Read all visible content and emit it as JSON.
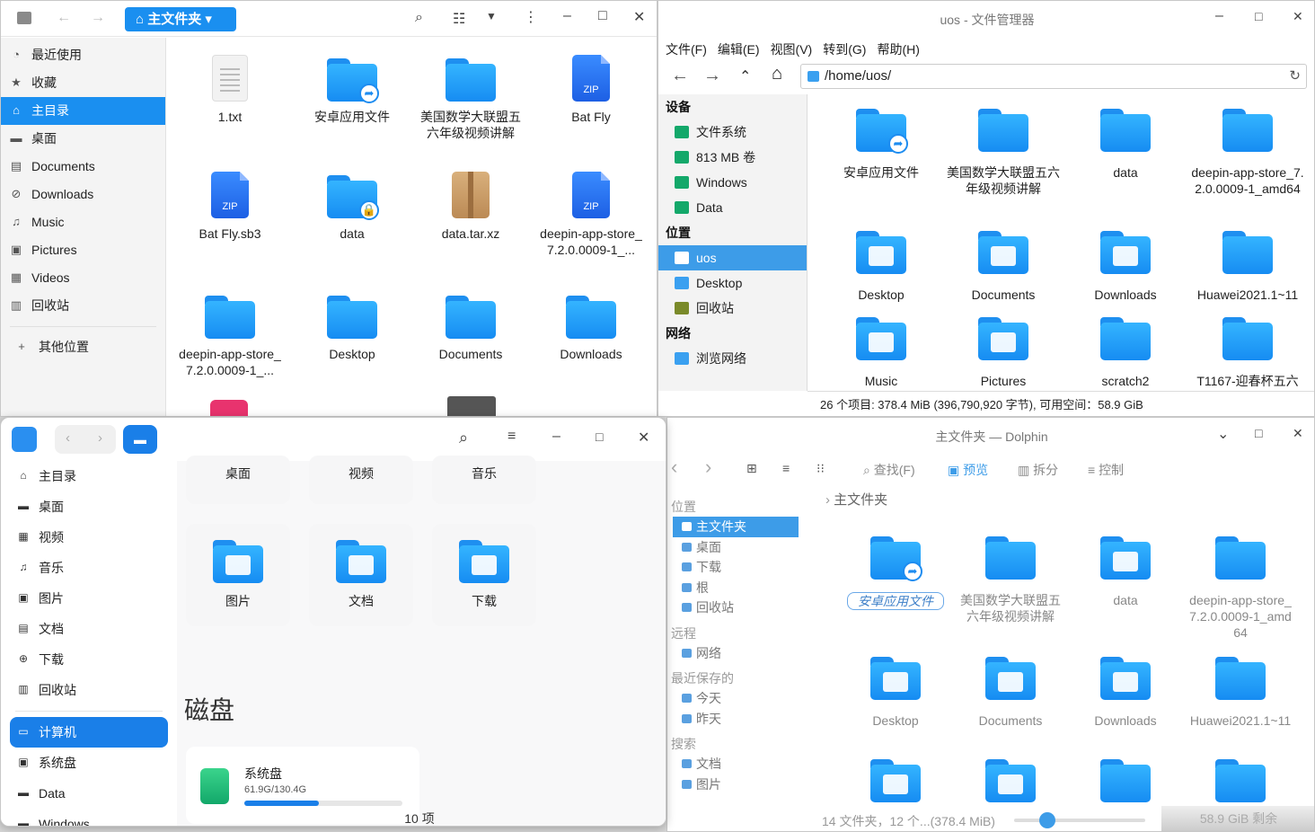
{
  "w1": {
    "path_label": "主文件夹",
    "sidebar": [
      {
        "icon": "clock-icon",
        "label": "最近使用",
        "glyph": "◔"
      },
      {
        "icon": "star-icon",
        "label": "收藏",
        "glyph": "★"
      },
      {
        "icon": "home-icon",
        "label": "主目录",
        "glyph": "⌂",
        "selected": true
      },
      {
        "icon": "desktop-icon",
        "label": "桌面",
        "glyph": "▬"
      },
      {
        "icon": "document-icon",
        "label": "Documents",
        "glyph": "▤"
      },
      {
        "icon": "download-icon",
        "label": "Downloads",
        "glyph": "⊘"
      },
      {
        "icon": "music-icon",
        "label": "Music",
        "glyph": "♫"
      },
      {
        "icon": "picture-icon",
        "label": "Pictures",
        "glyph": "▣"
      },
      {
        "icon": "video-icon",
        "label": "Videos",
        "glyph": "▦"
      },
      {
        "icon": "trash-icon",
        "label": "回收站",
        "glyph": "▥"
      }
    ],
    "other_places": "其他位置",
    "files": [
      {
        "name": "1.txt",
        "kind": "txt"
      },
      {
        "name": "安卓应用文件",
        "kind": "folder",
        "badge": "➦"
      },
      {
        "name": "美国数学大联盟五六年级视频讲解",
        "kind": "folder"
      },
      {
        "name": "Bat Fly",
        "kind": "zip"
      },
      {
        "name": "Bat Fly.sb3",
        "kind": "zip"
      },
      {
        "name": "data",
        "kind": "folder",
        "badge": "🔒"
      },
      {
        "name": "data.tar.xz",
        "kind": "tar"
      },
      {
        "name": "deepin-app-store_ 7.2.0.0009-1_...",
        "kind": "zip"
      },
      {
        "name": "deepin-app-store_ 7.2.0.0009-1_...",
        "kind": "folder"
      },
      {
        "name": "Desktop",
        "kind": "folder"
      },
      {
        "name": "Documents",
        "kind": "folder"
      },
      {
        "name": "Downloads",
        "kind": "folder"
      }
    ]
  },
  "w2": {
    "title": "uos - 文件管理器",
    "menu": [
      "文件(F)",
      "编辑(E)",
      "视图(V)",
      "转到(G)",
      "帮助(H)"
    ],
    "address": "/home/uos/",
    "sections": [
      {
        "header": "设备",
        "items": [
          "文件系统",
          "813 MB 卷",
          "Windows",
          "Data"
        ]
      },
      {
        "header": "位置",
        "items": [
          "uos",
          "Desktop",
          "回收站"
        ]
      },
      {
        "header": "网络",
        "items": [
          "浏览网络"
        ]
      }
    ],
    "selected_item": "uos",
    "files": [
      "安卓应用文件",
      "美国数学大联盟五六年级视频讲解",
      "data",
      "deepin-app-store_7.2.0.0009-1_amd64",
      "Desktop",
      "Documents",
      "Downloads",
      "Huawei2021.1~11",
      "Music",
      "Pictures",
      "scratch2",
      "T1167-迎春杯五六"
    ],
    "status": "26 个项目: 378.4 MiB (396,790,920 字节), 可用空间：58.9 GiB"
  },
  "w3": {
    "sidebar": [
      {
        "icon": "home-icon",
        "label": "主目录",
        "glyph": "⌂"
      },
      {
        "icon": "desktop-icon",
        "label": "桌面",
        "glyph": "▬"
      },
      {
        "icon": "video-icon",
        "label": "视频",
        "glyph": "▦"
      },
      {
        "icon": "music-icon",
        "label": "音乐",
        "glyph": "♫"
      },
      {
        "icon": "picture-icon",
        "label": "图片",
        "glyph": "▣"
      },
      {
        "icon": "document-icon",
        "label": "文档",
        "glyph": "▤"
      },
      {
        "icon": "download-icon",
        "label": "下载",
        "glyph": "⊕"
      },
      {
        "icon": "trash-icon",
        "label": "回收站",
        "glyph": "▥"
      }
    ],
    "sidebar2": [
      {
        "icon": "computer-icon",
        "label": "计算机",
        "glyph": "▭",
        "selected": true
      },
      {
        "icon": "disk-icon",
        "label": "系统盘",
        "glyph": "▣"
      },
      {
        "icon": "disk-icon",
        "label": "Data",
        "glyph": "▬"
      },
      {
        "icon": "disk-icon",
        "label": "Windows",
        "glyph": "▬"
      }
    ],
    "top_cards": [
      "桌面",
      "视频",
      "音乐"
    ],
    "cards": [
      "图片",
      "文档",
      "下载"
    ],
    "disk_section": "磁盘",
    "disk": {
      "name": "系统盘",
      "usage": "61.9G/130.4G",
      "fill": 0.47
    },
    "count": "10 项"
  },
  "w4": {
    "title": "主文件夹 — Dolphin",
    "toolbar": {
      "find": "查找(F)",
      "preview": "预览",
      "split": "拆分",
      "control": "控制"
    },
    "breadcrumb": "主文件夹",
    "sections": [
      {
        "header": "位置",
        "items": [
          "主文件夹",
          "桌面",
          "下载",
          "根",
          "回收站"
        ]
      },
      {
        "header": "远程",
        "items": [
          "网络"
        ]
      },
      {
        "header": "最近保存的",
        "items": [
          "今天",
          "昨天"
        ]
      },
      {
        "header": "搜索",
        "items": [
          "文档",
          "图片"
        ]
      }
    ],
    "files": [
      "安卓应用文件",
      "美国数学大联盟五六年级视频讲解",
      "data",
      "deepin-app-store_7.2.0.0009-1_amd64",
      "Desktop",
      "Documents",
      "Downloads",
      "Huawei2021.1~11"
    ],
    "status": "14 文件夹，12 个...(378.4 MiB)",
    "free": "58.9 GiB 剩余"
  },
  "colors": {
    "accent": "#1a8ff0",
    "folder": "#2aa6fb"
  }
}
